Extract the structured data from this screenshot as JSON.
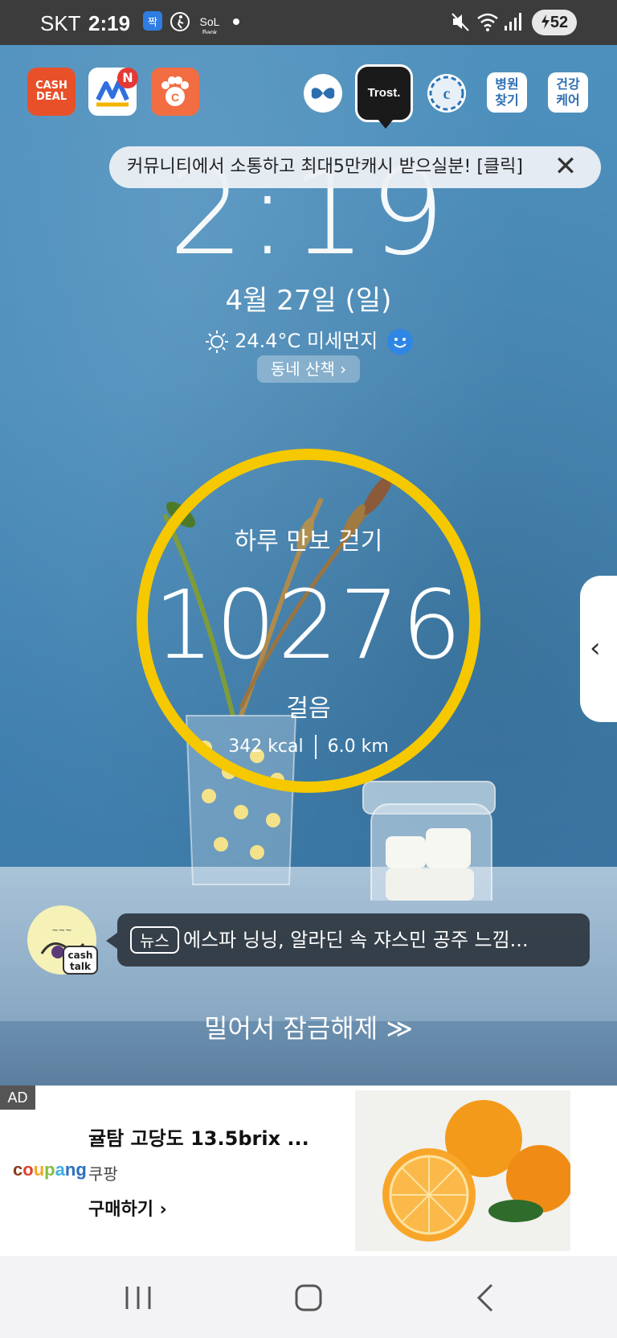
{
  "status_bar": {
    "carrier": "SKT",
    "time": "2:19",
    "battery_level": "52",
    "icons": [
      "app-notification-icon",
      "walk-icon",
      "sol-bank-icon",
      "dot-icon",
      "mute-icon",
      "wifi-icon",
      "signal-icon",
      "battery-charging-icon"
    ]
  },
  "top_apps": {
    "cashdeal_label": "CASH DEAL",
    "market_badge": "N",
    "trost_label": "Trost.",
    "hospital_label": "병원 찾기",
    "health_label": "건강 케어"
  },
  "notice": {
    "text": "커뮤니티에서 소통하고 최대5만캐시 받으실분! [클릭]"
  },
  "lock": {
    "clock": "2:19",
    "date": "4월 27일 (일)",
    "temperature": "24.4°C",
    "dust_label": "미세먼지",
    "walk_button": "동네 산책 ›"
  },
  "steps": {
    "title": "하루 만보 걷기",
    "count": "10276",
    "unit": "걸음",
    "kcal": "342 kcal",
    "distance": "6.0 km",
    "ring_color": "#f5c800"
  },
  "news": {
    "badge_text": "cash talk",
    "tag": "뉴스",
    "headline": "에스파 닝닝, 알라딘 속 쟈스민 공주 느낌..."
  },
  "unlock_text": "밀어서 잠금해제 ≫",
  "ad": {
    "tag": "AD",
    "brand": "coupang",
    "title": "귤탐 고당도 13.5brix ...",
    "seller": "쿠팡",
    "cta": "구매하기 ›"
  },
  "colors": {
    "accent_yellow": "#f5c800",
    "status_bar": "#3c3c3c"
  }
}
